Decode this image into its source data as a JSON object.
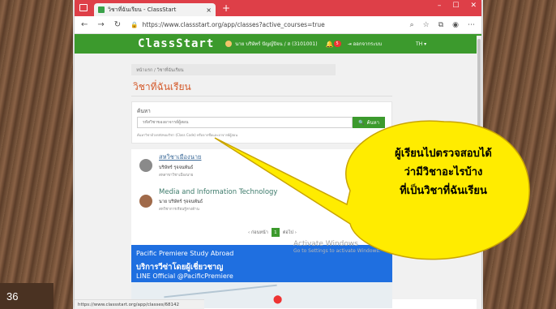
{
  "slide": {
    "number": "36"
  },
  "browser": {
    "tab_title": "วิชาที่ฉันเรียน - ClassStart",
    "tab_close": "×",
    "new_tab": "+",
    "win_controls": [
      "–",
      "☐",
      "✕"
    ],
    "url": "https://www.classstart.org/app/classes?active_courses=true",
    "status_url": "https://www.classstart.org/app/classes/68142"
  },
  "site": {
    "logo": "ClassStart",
    "user": "นาย บริษัทร์ ปัญญ์ปิจน / ส (3101001)",
    "notifications": "5",
    "logout": "ออกจากระบบ",
    "lang": "TH ▾"
  },
  "breadcrumb": "หน้าแรก / วิชาที่ฉันเรียน",
  "page_title": "วิชาที่ฉันเรียน",
  "search": {
    "label": "ค้นหา",
    "placeholder": "รหัสวิชาของอาจารย์ผู้สอน",
    "button": "ค้นหา",
    "hint": "ค้นหาวิชาด้วยรหัสของวิชา (Class Code) หรือจากชื่อและอาจารย์ผู้สอน"
  },
  "courses": [
    {
      "name": "สหวิชาเมืองนาย",
      "teacher": "บริษัทร์ รุจจนพันธ์",
      "sub": "สหสาขาวิชาเมืองนาย"
    },
    {
      "name": "Media and Information Technology",
      "teacher": "นาย บริษัทร์ รุจจนพันธ์",
      "sub": "สหวิชาการเรียนรู้ทางด้าน"
    }
  ],
  "pagination": {
    "prev": "‹ ก่อนหน้า",
    "current": "1",
    "next": "ต่อไป ›"
  },
  "ad": {
    "title": "Pacific Premiere Study Abroad",
    "subtitle": "บริการวีซ่าโดยผู้เชี่ยวชาญ",
    "line": "LINE Official @PacificPremiere"
  },
  "watermark": {
    "title": "Activate Windows",
    "sub": "Go to Settings to activate Windows."
  },
  "callout": {
    "lines": [
      "ผู้เรียนไปตรวจสอบได้",
      "ว่ามีวิชาอะไรบ้าง",
      "ที่เป็นวิชาที่ฉันเรียน"
    ],
    "fill": "#ffec00",
    "stroke": "#c9a400"
  }
}
